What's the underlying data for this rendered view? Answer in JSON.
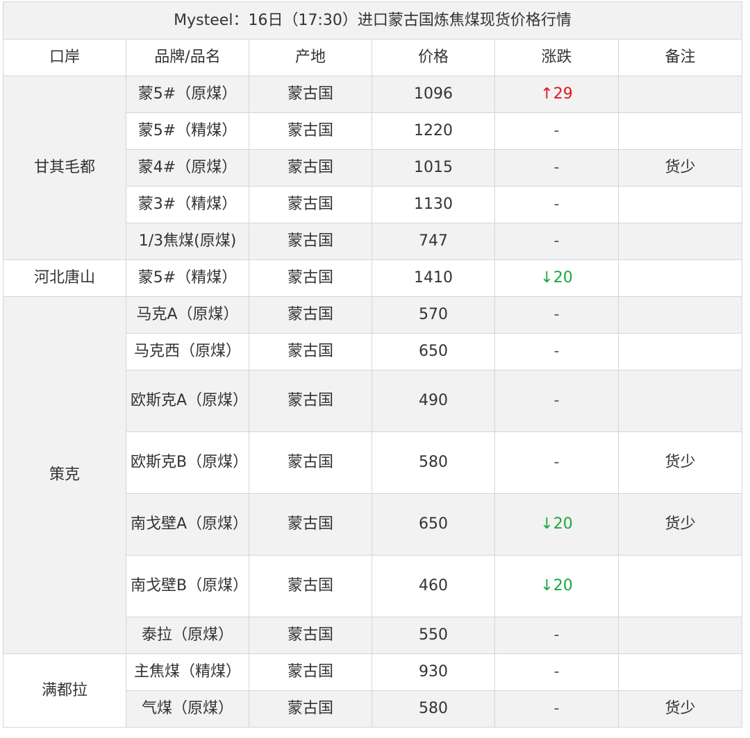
{
  "table": {
    "title": "Mysteel：16日（17:30）进口蒙古国炼焦煤现货价格行情",
    "headers": [
      "口岸",
      "品牌/品名",
      "产地",
      "价格",
      "涨跌",
      "备注"
    ],
    "groups": [
      {
        "port": "甘其毛都",
        "rows": [
          {
            "product": "蒙5#（原煤）",
            "origin": "蒙古国",
            "price": "1096",
            "change": "↑29",
            "trend": "up",
            "note": ""
          },
          {
            "product": "蒙5#（精煤）",
            "origin": "蒙古国",
            "price": "1220",
            "change": "-",
            "trend": "flat",
            "note": ""
          },
          {
            "product": "蒙4#（原煤）",
            "origin": "蒙古国",
            "price": "1015",
            "change": "-",
            "trend": "flat",
            "note": "货少"
          },
          {
            "product": "蒙3#（精煤）",
            "origin": "蒙古国",
            "price": "1130",
            "change": "-",
            "trend": "flat",
            "note": ""
          },
          {
            "product": "1/3焦煤(原煤)",
            "origin": "蒙古国",
            "price": "747",
            "change": "-",
            "trend": "flat",
            "note": ""
          }
        ]
      },
      {
        "port": "河北唐山",
        "rows": [
          {
            "product": "蒙5#（精煤）",
            "origin": "蒙古国",
            "price": "1410",
            "change": "↓20",
            "trend": "down",
            "note": ""
          }
        ]
      },
      {
        "port": "策克",
        "rows": [
          {
            "product": "马克A（原煤）",
            "origin": "蒙古国",
            "price": "570",
            "change": "-",
            "trend": "flat",
            "note": ""
          },
          {
            "product": "马克西（原煤）",
            "origin": "蒙古国",
            "price": "650",
            "change": "-",
            "trend": "flat",
            "note": ""
          },
          {
            "product": "欧斯克A（原煤）",
            "origin": "蒙古国",
            "price": "490",
            "change": "-",
            "trend": "flat",
            "note": ""
          },
          {
            "product": "欧斯克B（原煤）",
            "origin": "蒙古国",
            "price": "580",
            "change": "-",
            "trend": "flat",
            "note": "货少"
          },
          {
            "product": "南戈壁A（原煤）",
            "origin": "蒙古国",
            "price": "650",
            "change": "↓20",
            "trend": "down",
            "note": "货少"
          },
          {
            "product": "南戈壁B（原煤）",
            "origin": "蒙古国",
            "price": "460",
            "change": "↓20",
            "trend": "down",
            "note": ""
          },
          {
            "product": "泰拉（原煤）",
            "origin": "蒙古国",
            "price": "550",
            "change": "-",
            "trend": "flat",
            "note": ""
          }
        ]
      },
      {
        "port": "满都拉",
        "rows": [
          {
            "product": "主焦煤（精煤）",
            "origin": "蒙古国",
            "price": "930",
            "change": "-",
            "trend": "flat",
            "note": ""
          },
          {
            "product": "气煤（原煤）",
            "origin": "蒙古国",
            "price": "580",
            "change": "-",
            "trend": "flat",
            "note": "货少"
          }
        ]
      }
    ]
  }
}
